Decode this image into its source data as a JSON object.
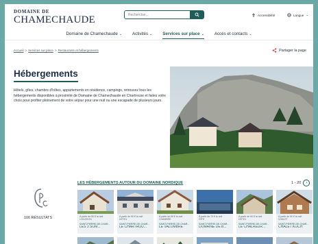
{
  "header": {
    "logo_line1": "DOMAINE DE",
    "logo_line2": "CHAMECHAUDE",
    "search_placeholder": "Rechercher...",
    "accessibility_label": "Accessibilité",
    "language_label": "Langue",
    "language_chevron": "⌄"
  },
  "nav": {
    "items": [
      {
        "label": "Domaine de Chamechaude",
        "chevron": "⌄"
      },
      {
        "label": "Activités",
        "chevron": "⌄"
      },
      {
        "label": "Services sur place",
        "chevron": "⌄"
      },
      {
        "label": "Accès et contacts",
        "chevron": "⌄"
      }
    ]
  },
  "breadcrumb": [
    "Accueil",
    "Services sur place",
    "Restaurants et hébergements"
  ],
  "breadcrumb_separator": ">",
  "share_label": "Partager la page",
  "page": {
    "title": "Hébergements",
    "intro": "Hôtels, gîtes, chambre d'hôtes, appartements en résidence, campings, retrouvez tous les hébergements disponibles à proximité de Domaine de Chamechaude en Chartreuse et faites votre choix pour profiter pleinement de votre séjour pour une nuit ou une escapade de plusieurs jours."
  },
  "results": {
    "count_label": "106 RÉSULTATS",
    "section_title": "LES HÉBERGEMENTS AUTOUR DU DOMAINE NORDIQUE",
    "pager": "1 - 20",
    "pager_next": "›"
  },
  "cards": [
    {
      "tag": "À partir de 80 € la nuit",
      "sub": "LOCATION",
      "loc": "SAINT-PIERRE-DE-CHAR...",
      "name": "LES 3 SOM..."
    },
    {
      "tag": "À partir de 55 € la nuit",
      "sub": "HÔTEL",
      "loc": "SAINT-PIERRE-DE-CHAR...",
      "name": "LE CHARTROU..."
    },
    {
      "tag": "À partir de 65 € la nuit",
      "sub": "CHAMBRE",
      "loc": "SAINT-PIERRE-DE-CHAR...",
      "name": "LE VALOMBRE"
    },
    {
      "tag": "À partir de 70 € la nuit",
      "sub": "GÎTE",
      "loc": "SAINT-PIERRE-DE-CHAR...",
      "name": "DOMAINE DE B..."
    },
    {
      "tag": "À partir de 60 € la nuit",
      "sub": "HÔTEL",
      "loc": "SAINT-PIERRE-DE-CHAR...",
      "name": "LE CHALREUR..."
    },
    {
      "tag": "À partir de 90 € la nuit",
      "sub": "CHALET",
      "loc": "SAINT-PIERRE-DE-CHAR...",
      "name": "CHALET KOCH"
    }
  ],
  "colors": {
    "frame": "#6aa9a5",
    "brand": "#1f5c5a",
    "navy": "#1d2d4a"
  }
}
